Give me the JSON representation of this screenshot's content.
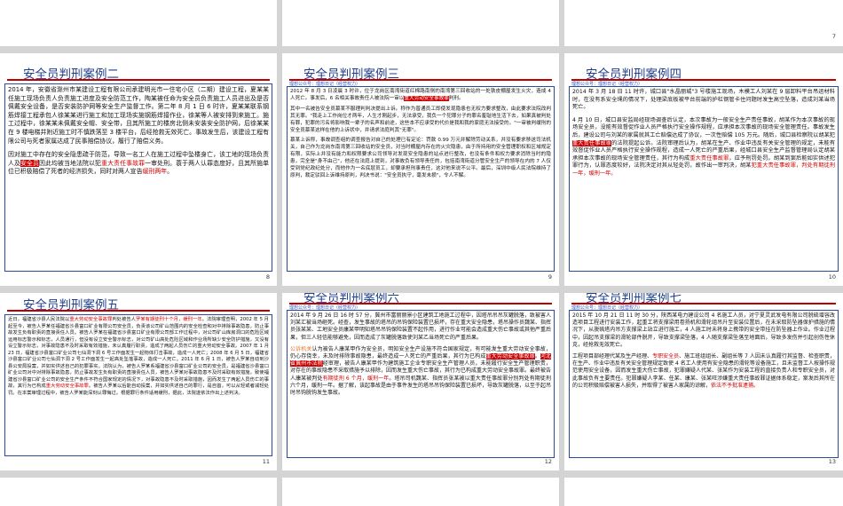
{
  "pages": {
    "p7": "7",
    "p8": "8",
    "p9": "9",
    "p10": "10",
    "p11": "11",
    "p12": "12",
    "p13": "13"
  },
  "c2": {
    "title": "安全员判刑案例二",
    "p1a": "2014 年，安徽省滁州市某建设工程有限公司承建明光市一住宅小区（二期）建设工程，夏某某任施工现场负责人负责施工进度及安全防范工作，陶某被任命为安全员负责施工人员进出及是否佩戴安全设备，是否安装防护网等安全生产监督工作。第二年 8 月 1 日 6 时许，夏某某联系钢筋焊接工程承包人徐某某进行施工和加工现场实施钢筋焊接作业，徐某等人被安排到来施工。施工过程中，徐某某未佩戴安全帽、安全带，且其所施工的楼房北侧未安装安全防护网，后徐某某在 9 楼电梯井附近施工时不慎跌落至 3 楼平台，后经抢救无效死亡。事故发生后，该建设工程有限公司与死者家属达成了民事赔偿协议，履行了赔偿义务。",
    "p2a": "因对施工中存在的安全隐患疏于防范，导致一名工人在施工过程中坠楼身亡，该工地的现场负责人及",
    "p2hl": "安全员",
    "p2b": "因此均被当地法院以犯",
    "p2red": "重大责任事故罪",
    "p2c": "一审处刑。蓑于两人认罪态度好，且其所施单位已积极赔偿了死者的经济损失，同时对两人宣告",
    "p2red2": "缓刑两年",
    "p2d": "。"
  },
  "c3": {
    "title": "安全员判刑案例三",
    "subtitle": "理想公众号：理想日记（经营权力）",
    "p1a": "2012 年 8 月 3 日凌晨 3 时许，位于龙岗区南湾街道红棉路南侧的南湾第三回收站的一处铁皮棚屋发生火灾，造成 4 人死亡。事发后，6 名相关事故责任人被法院一审以",
    "p1red": "重大劳动安全事故罪",
    "p1b": "判刑。",
    "p2": "其中一名被告安全员慕某不服理判判决提出上诉。称作为普通员工即使发现隐患也无权力要求整改，由此要求法院改判其无罪。\"我走上工作岗位才两年，人生才刚起步，无法承受，我负一个犯罪分子的罪名羞耻地生活下去，如果真被判处有罪，犯罪的污名将影响我一辈子的名声和前途，这些本不应承受的代价是我和我的家庭无法接受的。\"一审被判缓刑的安全员慕某这样在他的上诉状中，并请求法庭判其\"无罪\"。",
    "p3": "慕某上诉称，事故调查组的调查报告对自己的处理已有定论：罚款 0.99 万元并解除劳动关系，并没有要求移送司法机关，自己作为龙岗东南湾第三回收站的安全员，对当时棚屋内存在的火灾隐患，由于所持用的安全管理职权和区域规定有限，实际上并没有能力和权限要求公司领导对发现安全隐患的站点进行整改，也没有条件和权力要求消除当时的隐患，完全是\"身不由己\"，他还在法庭上提到，对事故负有领导责任的，包括南湾街道分管安全生产的领导在内的 7 人仅受到党纪政纪处分，而他作为一名底层员工，却要承担刑事责任，这对他来说不公平。最后，深圳中级人民法院维持了原判，裁定驳回上诉维持原判，判决书说：\"安全员执守，毫发未损\"，令人不解。"
  },
  "c4": {
    "title": "安全员判刑案例四",
    "subtitle": "理想公众号：理想日记（经营权力）",
    "p1": "2014 年 3 月 18 日 11 时许，城口县\"水晶丽城\"3 号楼施工现场，木模工人刘某在 9 层卸料平台吊运材料时，在没有系安全绳的情况下，处理梁底板被平台前端的护栏钢管卡住问题时发生高空坠落，造成刘某当场死亡。",
    "p2a": "4 月 10 日，城口县安监局经现场调查后认定，本次事故为一般安全生产责任事故，胡某作为本次事故的现场安全员，没能有效督促作业人员严格执行安全操作规程，应承担本次事故的现场安全管理责任。事故发生后，建设公司与刘某的家属就其工亡赔偿达成了协议，一次性赔偿 105 万元。随后，城口县检察院以胡某犯",
    "p2hl": "重大责任事故罪",
    "p2b": "的法院提起公诉。法院审理后认为，胡某在生产、作业中违反有关安全管理的规定，未能有效督促作业人员严格执行安全操作规程，造成一人死亡的严重后果，经城口县安全生产监督管理局认定胡某承担本次事故的现场安全管理责任，其行为构成",
    "p2red": "重大责任事故罪",
    "p2c": "，应予刑罚处罚。胡某到案后能如实供述犯罪行为，认罪态度较好，法院决定对其从轻处罚，故作出一审判决，胡某",
    "p2red2": "犯重大责任事故罪，判处有期徒刑一年，缓刑一年。"
  },
  "c5": {
    "title": "安全员判刑案例五",
    "p1a": "近日，福建省沙县人民法院以",
    "p1red": "重大劳动安全事故罪",
    "p1b": "判处被告人",
    "p1red2": "罗某有期徒刑十个月，缓刑一年",
    "p1c": "。法院审理查明，2002 年 5 月起至今，被告人罗某任福建省沙县富口矿业有限公司安全员，负责该公司矿山范围内的安全检查和对中排除事故隐患，防止事故发生负有职责的直接责任人员。被告人罗某在福建省沙县富口矿业有限公司部工作过程中，对公司矿山库房洞口的危险区域运用标志警示和标志，人员通行，但没有设立安全警示标志，对公司矿山高处危险区域和作业场所缺少安全防护措施，又没有设立警示标志，对事故隐患不及时采取有效措施，未认真履行职责，造成了两起人员伤亡的重大劳动安全事故。2007 年 1 月 23 日，福建省沙县富口矿业公司七仙洞下洞 6 号工作面发生一起物体打击事故，造成一人死亡；2008 年 6 月 5 日，福建省沙县富口矿业公司七仙洞下洞 2 号工作面发生一起高处坠落事故，造成一人死亡。2011 年 6 月 1 日，被告人罗某自动到沙县公安局投案，并如实供述自己的犯罪事实。法院认为，被告人罗某系福建省沙县富口矿业公司的安全员，是福建省沙县富口矿业公司对中对排除事故隐患，防止事故发生负有职责的直接责任人员，被告人罗某对事故隐患不及时采取有效措施，致使福建省沙县富口矿业公司的安全生产条件不符合国家规定的情况下，对事故隐患不及时采取措施，因而发生了两起人员伤亡的事故，其行为已构成",
    "p1red3": "重大劳动安全事故罪",
    "p1d": "。被告人罗某以后能自动投案，并如实供述自己的罪行，是自首，可以从轻或者减轻处罚。在本案审理过程中，被告人罗某能深刻认罪悔过。根据罪行条件适用缓刑，据此，法院遂依法作出上述判决。"
  },
  "c6": {
    "title": "安全员判刑案例六",
    "subtitle": "理想公众号：理想日记（经营权力）",
    "p1": "2014 年 9 月 26 日 16 时 57 分，冀州市富丽丽景小区建筑工地施工过程中，因塔吊吊吊灰罐脱落，致被害人刘某汇被当场砸死。经查，发生事故的塔吊的吊钩保险装置已损坏，存在重大安全隐患，塔吊操作员魏某、指挥员张某某、工地安全员康某甲明知塔吊吊钩保险装置不起作用，进行作业可能会造成重大伤亡事故或其他严重后果，但三人轻信能够避免，因而造成了灰罐脱落致使刘某乙当场死亡的严重后果。",
    "p2org": "公诉机关",
    "p2a": "认为被告人康某甲作为安全员，明知安全生产设施不符合国家规定，有可能发生重大劳动安全事故，仍心存侥幸，未及时排除事故隐患，最终造成一人死亡的严重后果，其行为已构成",
    "p2hl": "重大劳动安全事故罪",
    "p2b": "。",
    "p2red": "河北省冀州市法院",
    "p2c": "经审理，被告人康某甲作为建筑施工企业专职安全生产管理人员，未能履行安全生产管理职责，对存在的事故隐患不采取措施予以排除，因而发生重大伤亡事故，其行为已构成重大劳动安全事故罪。最终被告人康某被判处",
    "p2red2": "有期徒刑 6 个月，缓刑一年",
    "p2d": "。塔吊司机魏某、指挥员张某被以重大责任事故罪分别判处有期徒刑六个月，缓刑一年。据了解，该起事故是由于事件发生的塔吊吊钩保险装置已损坏，导致灰罐脱落，以至于起吊时吊钩脱钩发生事故。"
  },
  "c7": {
    "title": "安全员判刑案例七",
    "subtitle": "理想公众号：理想日记（经营权力）",
    "p1": "2015 年 10 月 21 日 11 时 30 分，陕西某电力建设公司 4 名施工人员，对宁夏灵武发电有限公司脱硫增容改造项目工程进行安装工作，起重工将支撑梁用卷扬机和滑轮组吊升至安装位置后，在未采取防坠器保护措施的情况下，从脱硫塔内吊方支撑梁上站立进行施工，4 人施工时未将身上携带的安全带挂在防坠器上作业。作业过程中，因起吊支撑梁的滑轮部件脱开，导致支撑梁坠落，4 人随支撑梁坠落至地面后，导致多发伤并引起创伤性休克，经抢救无效死亡。",
    "p2a": "工程项目部经理代某及生产经理、",
    "p2red": "专职安全员",
    "p2b": "、施工班组组长、副组长等 7 人因未认真履行其监督、检查职责，在生产、作业中违反有关安全管理规定致使 4 名工人使用有安全隐患的滑轮等设备施工，且未监督工人按操作规范使用安全设备，因而发生重大伤亡事故，犯罪嫌疑人代某、张某作为安装工程的直接负责人和专职安全员，对此事故负有主要责任。犯罪嫌疑人李某、任某、康某、张某旺涉嫌重大责任事故罪证据体系稳定，案发后其所在的公司积极赔偿被害人损失，并取得了被害人家属的谅解，",
    "p2red2": "依法不予批准逮捕。"
  }
}
